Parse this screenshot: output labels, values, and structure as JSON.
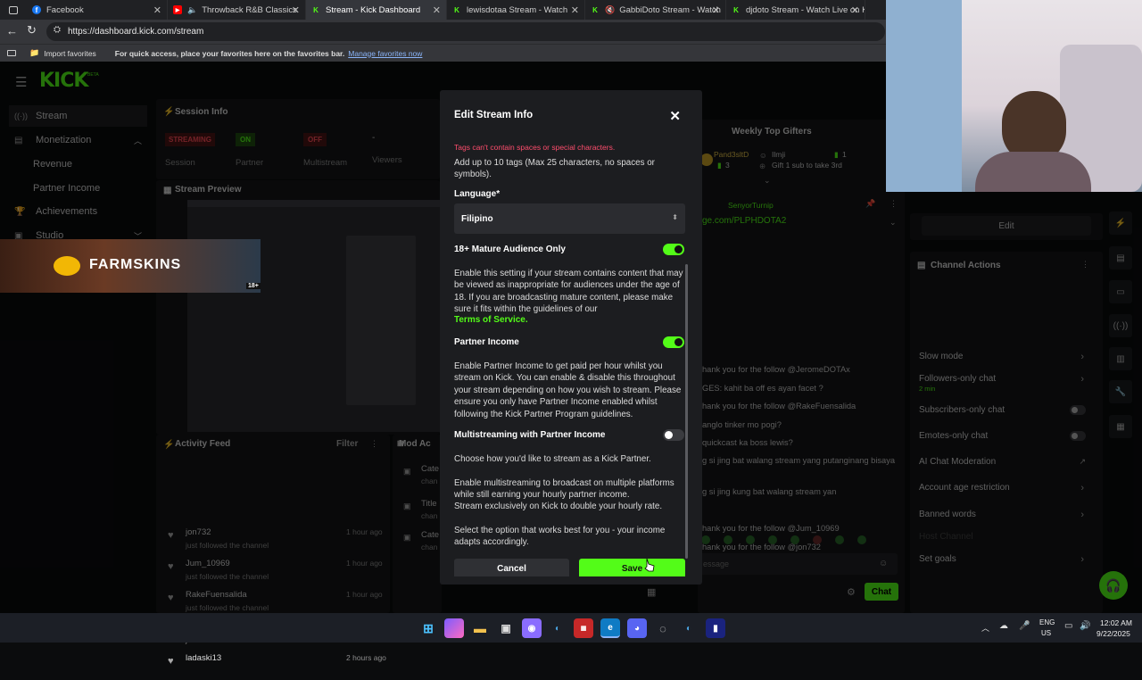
{
  "browser": {
    "tabs": [
      {
        "title": "Facebook",
        "color": "#1877f2",
        "glyph": "f"
      },
      {
        "title": "Throwback R&B Classics",
        "color": "#ff0000",
        "glyph": "▶"
      },
      {
        "title": "Stream - Kick Dashboard",
        "color": "#53fc18",
        "glyph": "K"
      },
      {
        "title": "lewisdotaa Stream - Watch",
        "color": "#53fc18",
        "glyph": "K"
      },
      {
        "title": "GabbiDoto Stream - Watch",
        "color": "#53fc18",
        "glyph": "K"
      },
      {
        "title": "djdoto Stream - Watch Live on K",
        "color": "#53fc18",
        "glyph": "K"
      }
    ],
    "url": "https://dashboard.kick.com/stream",
    "favorites": {
      "import": "Import favorites",
      "hint": "For quick access, place your favorites here on the favorites bar.",
      "manage": "Manage favorites now"
    }
  },
  "sidebar": {
    "logo": "KICK",
    "logo_badge": "BETA",
    "items": [
      {
        "label": "Stream",
        "icon": "stream-icon"
      },
      {
        "label": "Monetization",
        "icon": "money-icon"
      },
      {
        "label": "Revenue",
        "icon": ""
      },
      {
        "label": "Partner Income",
        "icon": ""
      },
      {
        "label": "Achievements",
        "icon": "trophy-icon"
      },
      {
        "label": "Studio",
        "icon": "studio-icon"
      }
    ]
  },
  "session": {
    "title": "Session Info",
    "stats": [
      {
        "badge": "STREAMING",
        "label": "Session",
        "badge_color": "#e53935"
      },
      {
        "badge": "ON",
        "label": "Partner",
        "badge_color": "#53fc18"
      },
      {
        "badge": "OFF",
        "label": "Multistream",
        "badge_color": "#e53935"
      },
      {
        "badge": "-",
        "label": "Viewers",
        "badge_color": ""
      }
    ]
  },
  "preview": {
    "title": "Stream Preview"
  },
  "overlay_banner": {
    "brand": "FARMSKINS",
    "rating": "18+"
  },
  "activity": {
    "title": "Activity Feed",
    "filter": "Filter",
    "rows": [
      {
        "user": "jon732",
        "action": "just followed the channel",
        "time": "1 hour ago"
      },
      {
        "user": "Jum_10969",
        "action": "just followed the channel",
        "time": "1 hour ago"
      },
      {
        "user": "RakeFuensalida",
        "action": "just followed the channel",
        "time": "1 hour ago"
      },
      {
        "user": "JeromeDOTAx",
        "action": "just followed the channel",
        "time": "1 hour ago"
      },
      {
        "user": "ladaski13",
        "action": "",
        "time": "2 hours ago"
      }
    ]
  },
  "mod_actions": {
    "title": "Mod Ac",
    "rows": [
      {
        "label": "Cate",
        "sub": "chan"
      },
      {
        "label": "Title",
        "sub": "chan"
      },
      {
        "label": "Cate",
        "sub": "chan"
      }
    ]
  },
  "gifters": {
    "title": "Weekly Top Gifters",
    "first": {
      "name": "Pand3sltD",
      "count": "3"
    },
    "second": {
      "name": "Ilmji",
      "count": "1"
    },
    "note": "Gift 1 sub to take 3rd"
  },
  "chat": {
    "pinned_user": "SenyorTurnip",
    "pinned_link": "ge.com/PLPHDOTA2",
    "lines": [
      "hank you for the follow @JeromeDOTAx",
      "GES: kahit ba off es ayan facet ?",
      "hank you for the follow @RakeFuensalida",
      "anglo tinker mo pogi?",
      "quickcast ka boss lewis?",
      "g si jing bat walang stream yang putanginang bisaya",
      "g si jing kung bat walang stream yan",
      "hank you for the follow @Jum_10969",
      "hank you for the follow @jon732",
      ": JUST CHATTING NAL ANG"
    ],
    "input_placeholder": "essage",
    "send": "Chat"
  },
  "channel_actions": {
    "edit": "Edit",
    "title": "Channel Actions",
    "items": [
      {
        "label": "Slow mode",
        "sub": ""
      },
      {
        "label": "Followers-only chat",
        "sub": "2 min"
      },
      {
        "label": "Subscribers-only chat",
        "sub": ""
      },
      {
        "label": "Emotes-only chat",
        "sub": ""
      },
      {
        "label": "AI Chat Moderation",
        "sub": ""
      },
      {
        "label": "Account age restriction",
        "sub": ""
      },
      {
        "label": "Banned words",
        "sub": ""
      },
      {
        "label": "Host Channel",
        "sub": ""
      },
      {
        "label": "Set goals",
        "sub": ""
      }
    ]
  },
  "modal": {
    "title": "Edit Stream Info",
    "tag_error": "Tags can't contain spaces or special characters.",
    "tag_help": "Add up to 10 tags (Max 25 characters, no spaces or symbols).",
    "language_label": "Language*",
    "language_value": "Filipino",
    "mature_label": "18+ Mature Audience Only",
    "mature_on": true,
    "mature_desc": "Enable this setting if your stream contains content that may be viewed as inappropriate for audiences under the age of 18. If you are broadcasting mature content, please make sure it fits within the guidelines of our",
    "tos": "Terms of Service.",
    "partner_label": "Partner Income",
    "partner_on": true,
    "partner_desc": "Enable Partner Income to get paid per hour whilst you stream on Kick. You can enable & disable this throughout your stream depending on how you wish to stream. Please ensure you only have Partner Income enabled whilst following the Kick Partner Program guidelines.",
    "multi_label": "Multistreaming with Partner Income",
    "multi_on": false,
    "choose": "Choose how you'd like to stream as a Kick Partner.",
    "multi_desc1": "Enable multistreaming to broadcast on multiple platforms while still earning your hourly partner income.",
    "multi_desc2": "Stream exclusively on Kick to double your hourly rate.",
    "select_desc": "Select the option that works best for you - your income adapts accordingly.",
    "cancel": "Cancel",
    "save": "Save"
  },
  "taskbar": {
    "lang": "ENG",
    "region": "US",
    "time": "12:02 AM",
    "date": "9/22/2025"
  },
  "colors": {
    "kick_green": "#53fc18",
    "error_red": "#ff4d6d"
  }
}
